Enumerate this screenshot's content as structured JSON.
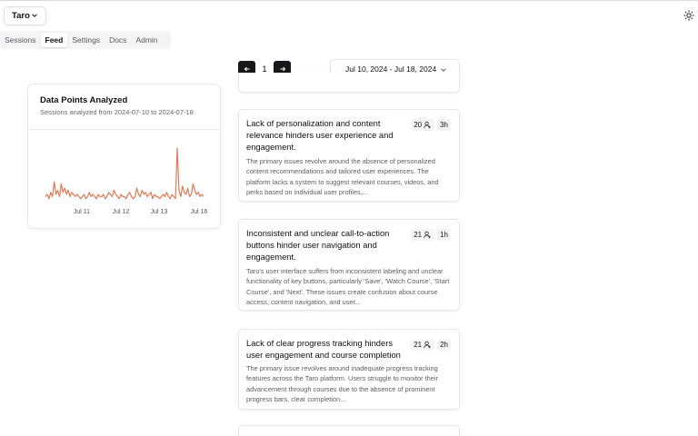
{
  "workspace": {
    "name": "Taro"
  },
  "tabs": [
    {
      "label": "Sessions"
    },
    {
      "label": "Feed"
    },
    {
      "label": "Settings"
    },
    {
      "label": "Docs"
    },
    {
      "label": "Admin"
    }
  ],
  "pagination": {
    "prev_icon": "arrow-left-icon",
    "page": "1",
    "next_icon": "arrow-right-icon"
  },
  "date_range": {
    "label": "Jul 10, 2024 - Jul 18, 2024"
  },
  "chart_card": {
    "title": "Data Points Analyzed",
    "subtitle": "Sessions analyzed from 2024-07-10 to 2024-07-18"
  },
  "chart_data": {
    "type": "line",
    "title": "Data Points Analyzed",
    "x_tick_labels": [
      "Jul 11",
      "Jul 12",
      "Jul 13",
      "Jul 16"
    ],
    "x_range": [
      "2024-07-10",
      "2024-07-18"
    ],
    "line_color": "#e07a55",
    "grid": false,
    "legend": "none",
    "series": [
      {
        "values": [
          2,
          3,
          1,
          4,
          2,
          9,
          3,
          5,
          2,
          8,
          4,
          6,
          3,
          5,
          2,
          4,
          3,
          2,
          3,
          2,
          1,
          2,
          3,
          1,
          2,
          4,
          2,
          3,
          2,
          1,
          3,
          2,
          2,
          3,
          1,
          2,
          4,
          3,
          2,
          5,
          3,
          2,
          1,
          3,
          2,
          2,
          1,
          3,
          4,
          2,
          1,
          2,
          6,
          3,
          2,
          5,
          3,
          4,
          2,
          3,
          4,
          1,
          3,
          2,
          2,
          1,
          2,
          3,
          2,
          4,
          2,
          1,
          3,
          2,
          1,
          25,
          5,
          2,
          7,
          4,
          3,
          6,
          2,
          3,
          8,
          5,
          3,
          4,
          2,
          3,
          2
        ]
      }
    ]
  },
  "feed": [
    {
      "title": "Lack of personalization and content relevance hinders user experience and engagement.",
      "description": "The primary issues revolve around the absence of personalized content recommendations and tailored user experiences. The platform lacks a system to suggest relevant courses, videos, and perks based on individual user profiles,...",
      "users": "20",
      "time": "3h"
    },
    {
      "title": "Inconsistent and unclear call-to-action buttons hinder user navigation and engagement.",
      "description": "Taro's user interface suffers from inconsistent labeling and unclear functionality of key buttons, particularly 'Save', 'Watch Course', 'Start Course', and 'Next'. These issues create confusion about course access, content navigation, and user...",
      "users": "21",
      "time": "1h"
    },
    {
      "title": "Lack of clear progress tracking hinders user engagement and course completion",
      "description": "The primary issue revolves around inadequate progress tracking features across the Taro platform. Users struggle to monitor their advancement through courses due to the absence of prominent progress bars, clear completion...",
      "users": "21",
      "time": "2h"
    }
  ],
  "icons": {
    "workspace_chevron": "chevron-down-icon",
    "date_chevron": "chevron-down-icon",
    "theme": "sun-icon",
    "users": "users-icon"
  }
}
